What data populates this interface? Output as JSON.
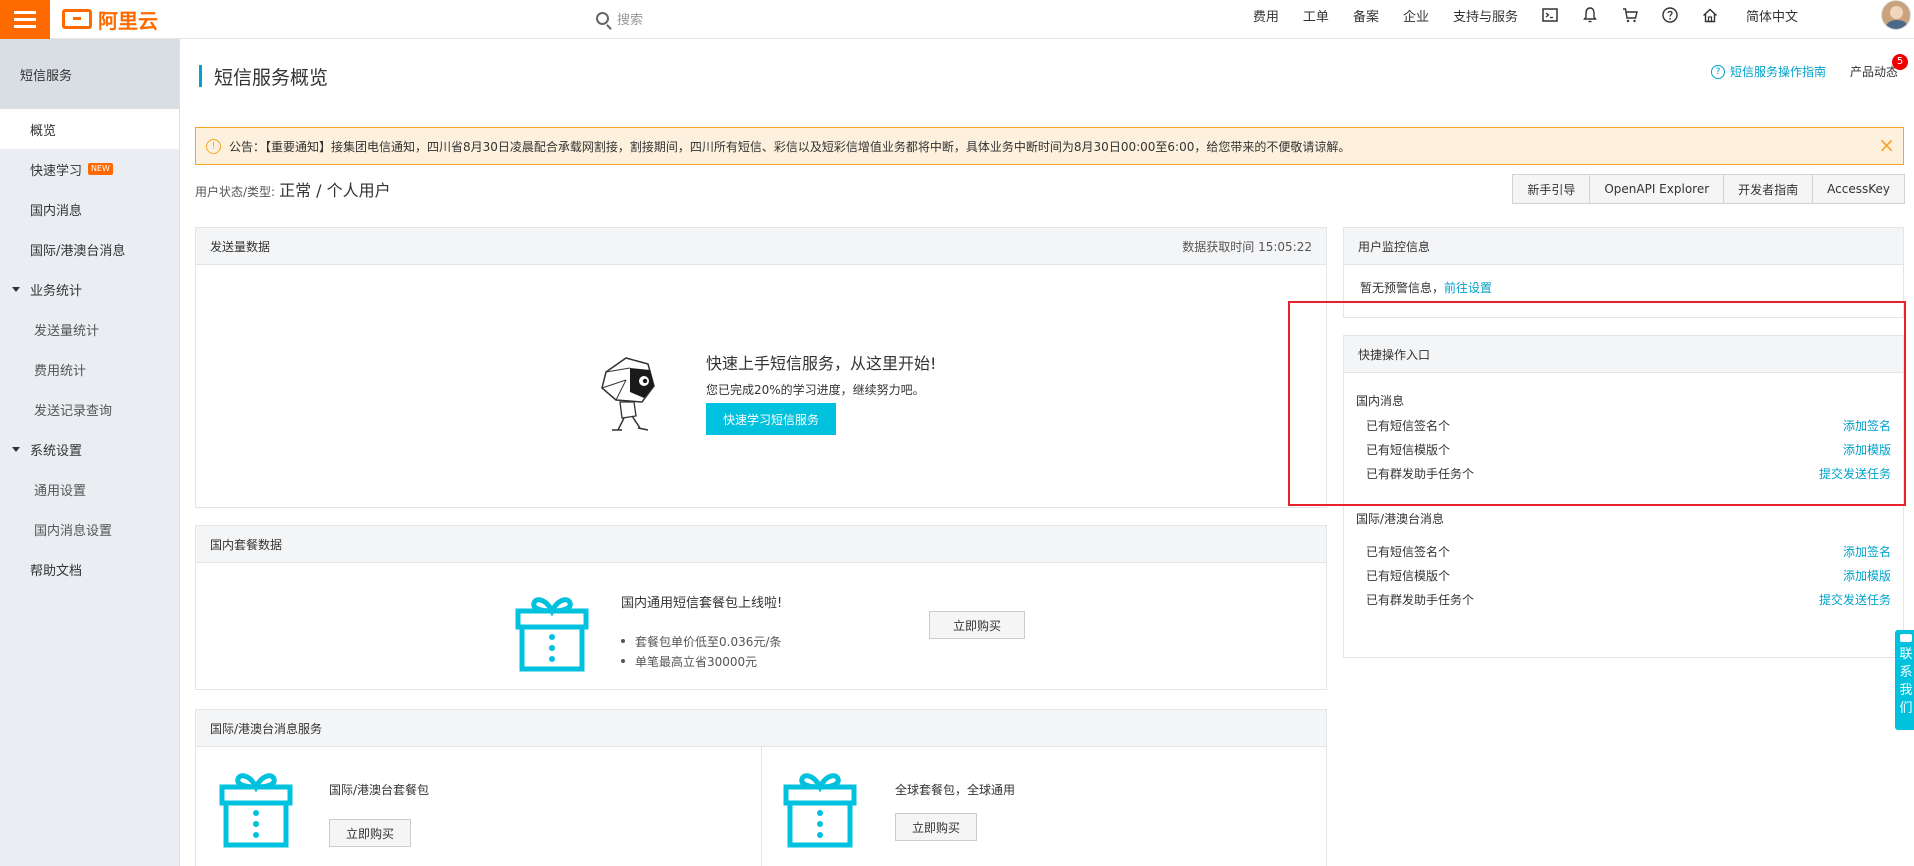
{
  "brand": {
    "name": "阿里云",
    "color": "#ff6a00",
    "accent": "#00c1de"
  },
  "topbar": {
    "search_placeholder": "搜索",
    "nav": [
      "费用",
      "工单",
      "备案",
      "企业",
      "支持与服务"
    ],
    "icons": [
      "terminal-icon",
      "bell-icon",
      "cart-icon",
      "help-icon",
      "home-icon"
    ],
    "language": "简体中文"
  },
  "sidebar": {
    "header": "短信服务",
    "items": [
      {
        "label": "概览",
        "type": "item",
        "active": true
      },
      {
        "label": "快速学习",
        "type": "item",
        "badge": "NEW"
      },
      {
        "label": "国内消息",
        "type": "item"
      },
      {
        "label": "国际/港澳台消息",
        "type": "item"
      },
      {
        "label": "业务统计",
        "type": "group"
      },
      {
        "label": "发送量统计",
        "type": "sub"
      },
      {
        "label": "费用统计",
        "type": "sub"
      },
      {
        "label": "发送记录查询",
        "type": "sub"
      },
      {
        "label": "系统设置",
        "type": "group"
      },
      {
        "label": "通用设置",
        "type": "sub"
      },
      {
        "label": "国内消息设置",
        "type": "sub"
      },
      {
        "label": "帮助文档",
        "type": "item"
      }
    ]
  },
  "page": {
    "title": "短信服务概览",
    "guide_link": "短信服务操作指南",
    "product_news": "产品动态",
    "product_news_count": "5"
  },
  "notice": {
    "text": "公告：【重要通知】接集团电信通知，四川省8月30日凌晨配合承载网割接，割接期间，四川所有短信、彩信以及短彩信增值业务都将中断，具体业务中断时间为8月30日00:00至6:00，给您带来的不便敬请谅解。"
  },
  "user_status": {
    "label": "用户状态/类型:",
    "value": "正常 / 个人用户"
  },
  "tool_buttons": [
    "新手引导",
    "OpenAPI Explorer",
    "开发者指南",
    "AccessKey"
  ],
  "send_panel": {
    "title": "发送量数据",
    "meta": "数据获取时间 15:05:22",
    "headline": "快速上手短信服务，从这里开始!",
    "progress_text": "您已完成20%的学习进度，继续努力吧。",
    "cta": "快速学习短信服务"
  },
  "package_panel": {
    "title": "国内套餐数据",
    "headline": "国内通用短信套餐包上线啦!",
    "bullets": [
      "套餐包单价低至0.036元/条",
      "单笔最高立省30000元"
    ],
    "button": "立即购买"
  },
  "intl_panel": {
    "title": "国际/港澳台消息服务",
    "left": {
      "label": "国际/港澳台套餐包",
      "button": "立即购买"
    },
    "right": {
      "label": "全球套餐包，全球通用",
      "button": "立即购买"
    }
  },
  "monitor_panel": {
    "title": "用户监控信息",
    "text": "暂无预警信息，",
    "link": "前往设置"
  },
  "quick_panel": {
    "title": "快捷操作入口",
    "sections": [
      {
        "title": "国内消息",
        "rows": [
          {
            "label": "已有短信签名个",
            "action": "添加签名"
          },
          {
            "label": "已有短信模版个",
            "action": "添加模版"
          },
          {
            "label": "已有群发助手任务个",
            "action": "提交发送任务"
          }
        ]
      },
      {
        "title": "国际/港澳台消息",
        "rows": [
          {
            "label": "已有短信签名个",
            "action": "添加签名"
          },
          {
            "label": "已有短信模版个",
            "action": "添加模版"
          },
          {
            "label": "已有群发助手任务个",
            "action": "提交发送任务"
          }
        ]
      }
    ]
  },
  "contact_tab": {
    "chars": [
      "联",
      "系",
      "我",
      "们"
    ]
  }
}
